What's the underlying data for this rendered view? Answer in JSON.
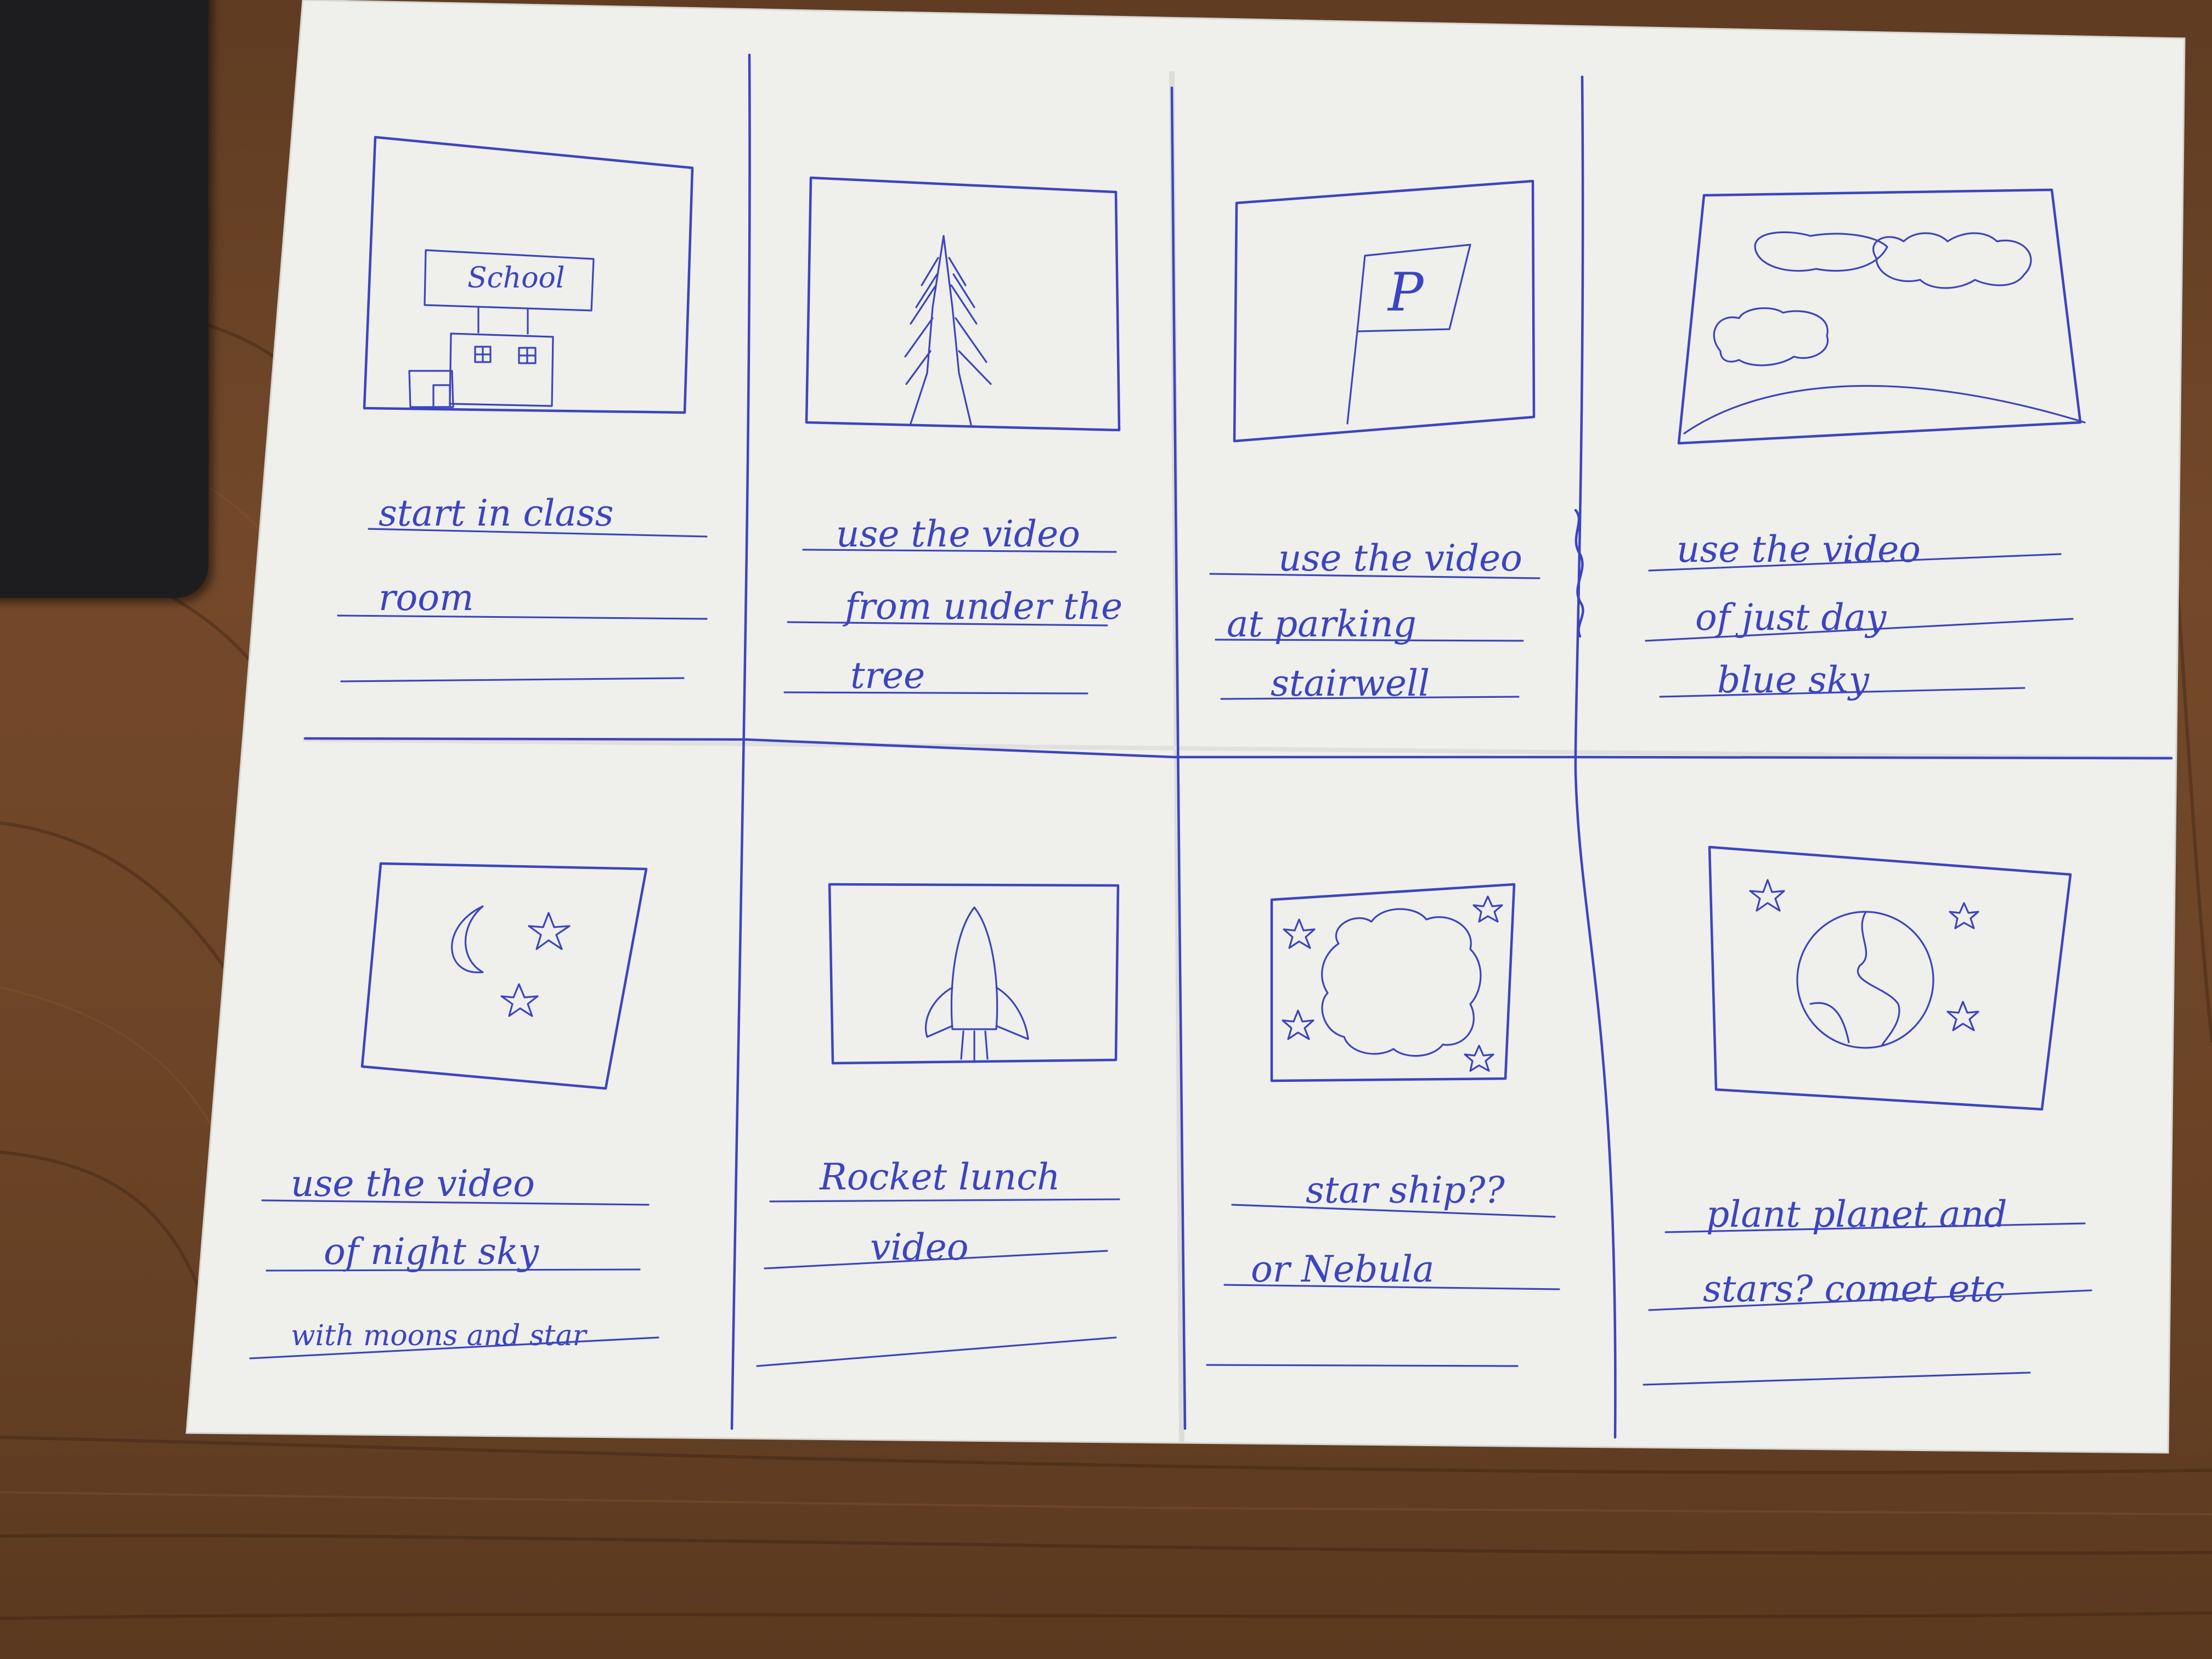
{
  "storyboard": {
    "panels": [
      {
        "sketch": "school-building",
        "sketch_label": "School",
        "caption_lines": [
          "start in class",
          "room",
          ""
        ]
      },
      {
        "sketch": "tree",
        "sketch_label": "",
        "caption_lines": [
          "use the video",
          "from under the",
          "tree"
        ]
      },
      {
        "sketch": "parking-sign",
        "sketch_label": "P",
        "caption_lines": [
          "use the video",
          "at parking",
          "stairwell"
        ]
      },
      {
        "sketch": "clouds-sky",
        "sketch_label": "",
        "caption_lines": [
          "use the video",
          "of just day",
          "blue sky"
        ]
      },
      {
        "sketch": "moon-stars",
        "sketch_label": "",
        "caption_lines": [
          "use the video",
          "of night sky",
          "with moons and star"
        ]
      },
      {
        "sketch": "rocket",
        "sketch_label": "",
        "caption_lines": [
          "Rocket lunch",
          "video",
          ""
        ]
      },
      {
        "sketch": "nebula-stars",
        "sketch_label": "",
        "caption_lines": [
          "star ship??",
          "or Nebula",
          ""
        ]
      },
      {
        "sketch": "planet-stars",
        "sketch_label": "",
        "caption_lines": [
          "plant planet and",
          "stars? comet etc",
          ""
        ]
      }
    ]
  },
  "colors": {
    "desk_wood": "#6b4527",
    "paper": "#efefec",
    "ink": "#3a44c4",
    "tablet": "#1d1d1f"
  }
}
